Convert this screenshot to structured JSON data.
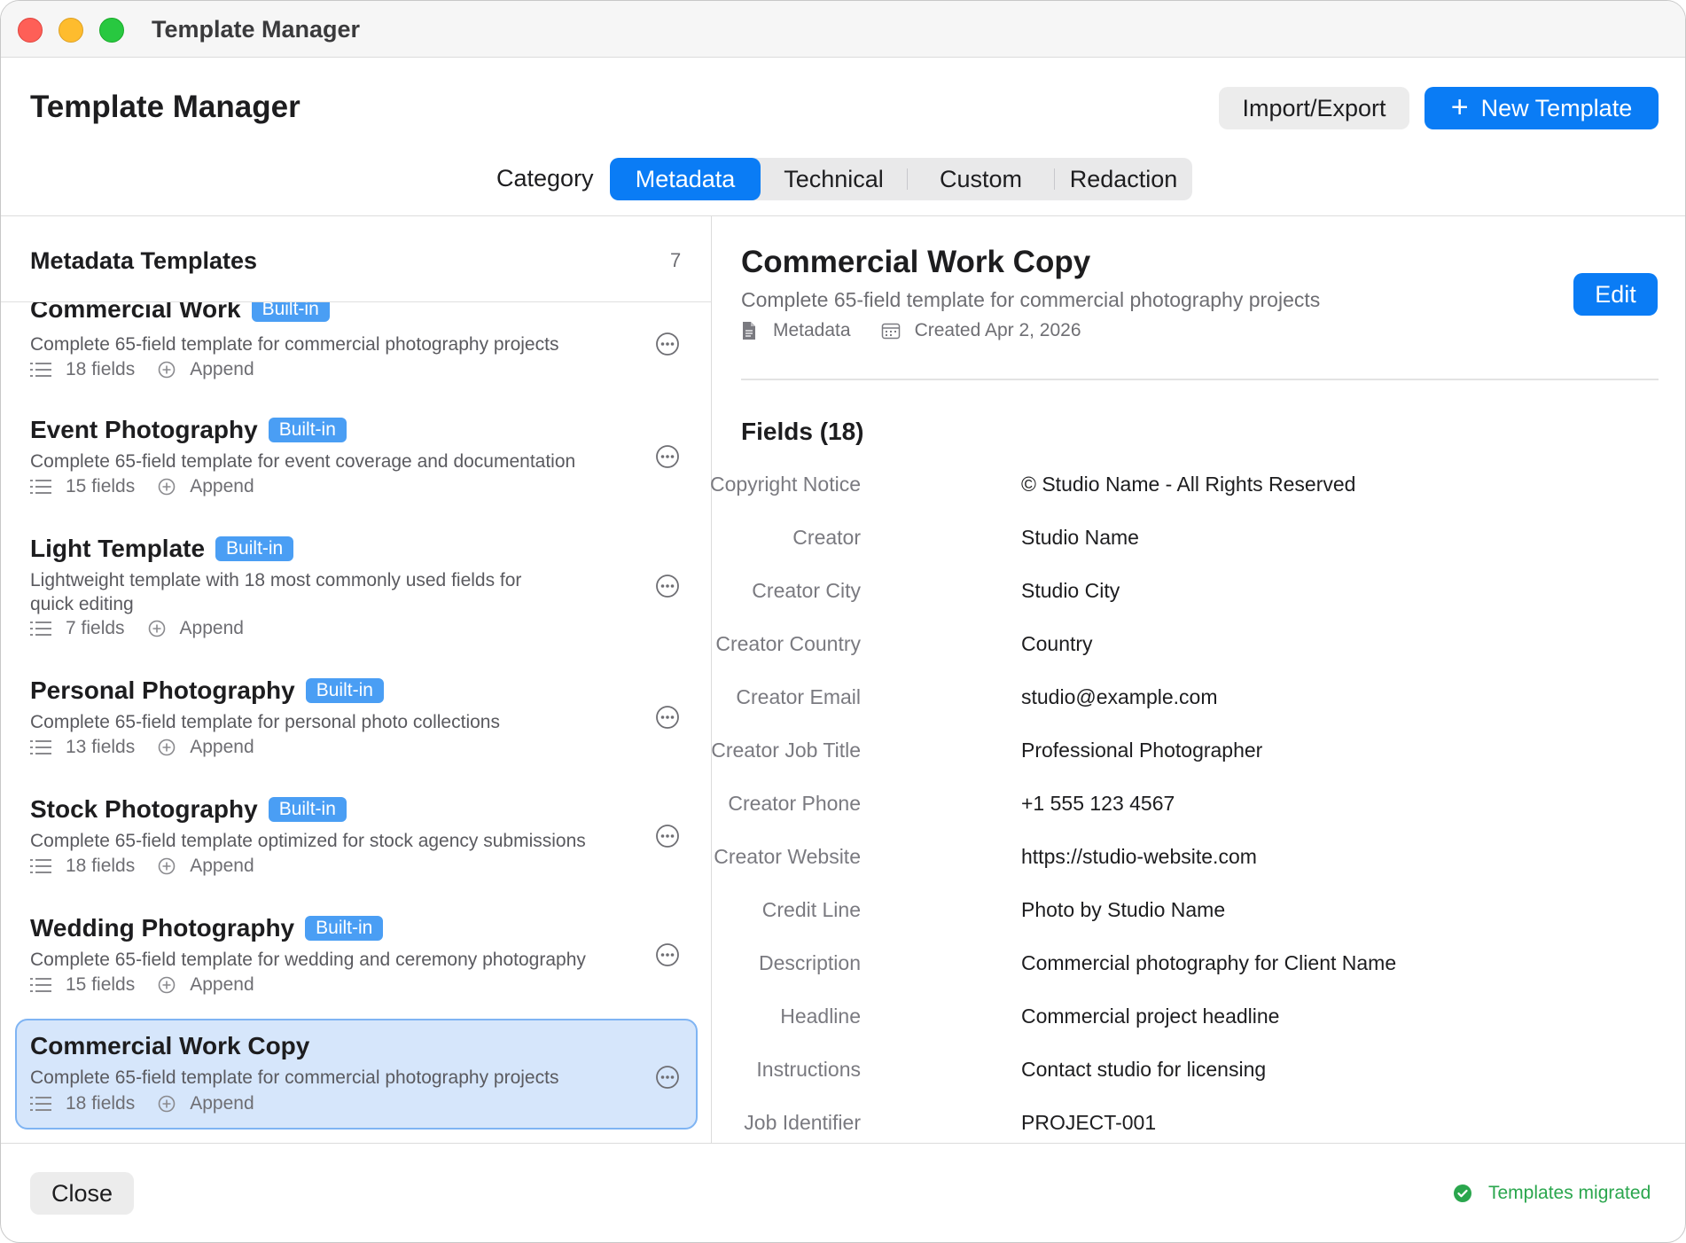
{
  "window": {
    "title": "Template Manager"
  },
  "header": {
    "title": "Template Manager",
    "import_export_label": "Import/Export",
    "new_template_label": "New Template"
  },
  "tabs": {
    "label": "Category",
    "items": [
      "Metadata",
      "Technical",
      "Custom",
      "Redaction"
    ],
    "active": "Metadata"
  },
  "list": {
    "title": "Metadata Templates",
    "count": "7",
    "items": [
      {
        "name": "Commercial Work",
        "badge": "Built-in",
        "description": "Complete 65-field template for commercial photography projects",
        "fields": "18 fields",
        "mode": "Append"
      },
      {
        "name": "Event Photography",
        "badge": "Built-in",
        "description": "Complete 65-field template for event coverage and documentation",
        "fields": "15 fields",
        "mode": "Append"
      },
      {
        "name": "Light Template",
        "badge": "Built-in",
        "description": "Lightweight template with 18 most commonly used fields for quick editing",
        "fields": "7 fields",
        "mode": "Append"
      },
      {
        "name": "Personal Photography",
        "badge": "Built-in",
        "description": "Complete 65-field template for personal photo collections",
        "fields": "13 fields",
        "mode": "Append"
      },
      {
        "name": "Stock Photography",
        "badge": "Built-in",
        "description": "Complete 65-field template optimized for stock agency submissions",
        "fields": "18 fields",
        "mode": "Append"
      },
      {
        "name": "Wedding Photography",
        "badge": "Built-in",
        "description": "Complete 65-field template for wedding and ceremony photography",
        "fields": "15 fields",
        "mode": "Append"
      },
      {
        "name": "Commercial Work Copy",
        "badge": "",
        "description": "Complete 65-field template for commercial photography projects",
        "fields": "18 fields",
        "mode": "Append"
      }
    ]
  },
  "detail": {
    "title": "Commercial Work Copy",
    "description": "Complete 65-field template for commercial photography projects",
    "category": "Metadata",
    "created": "Created Apr 2, 2026",
    "edit_label": "Edit",
    "fields_heading": "Fields (18)",
    "fields": [
      {
        "label": "Copyright Notice",
        "value": "© Studio Name - All Rights Reserved"
      },
      {
        "label": "Creator",
        "value": "Studio Name"
      },
      {
        "label": "Creator City",
        "value": "Studio City"
      },
      {
        "label": "Creator Country",
        "value": "Country"
      },
      {
        "label": "Creator Email",
        "value": "studio@example.com"
      },
      {
        "label": "Creator Job Title",
        "value": "Professional Photographer"
      },
      {
        "label": "Creator Phone",
        "value": "+1 555 123 4567"
      },
      {
        "label": "Creator Website",
        "value": "https://studio-website.com"
      },
      {
        "label": "Credit Line",
        "value": "Photo by Studio Name"
      },
      {
        "label": "Description",
        "value": "Commercial photography for Client Name"
      },
      {
        "label": "Headline",
        "value": "Commercial project headline"
      },
      {
        "label": "Instructions",
        "value": "Contact studio for licensing"
      },
      {
        "label": "Job Identifier",
        "value": "PROJECT-001"
      }
    ]
  },
  "footer": {
    "close_label": "Close",
    "status": "Templates migrated"
  },
  "colors": {
    "accent": "#0a7cf5",
    "badge": "#4a9ef4",
    "selection": "#d6e6fb",
    "success": "#2aa64d"
  }
}
